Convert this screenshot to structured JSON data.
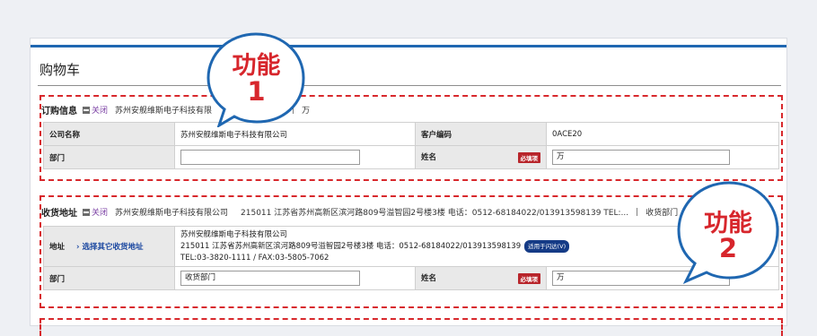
{
  "page": {
    "title": "购物车"
  },
  "order_section": {
    "header": {
      "name": "订购信息",
      "close_label": "关闭",
      "company": "苏州安舰维斯电子科技有限",
      "after": "万"
    },
    "rows": {
      "company_label": "公司名称",
      "company_value": "苏州安舰维斯电子科技有限公司",
      "code_label": "客户编码",
      "code_value": "0ACE20",
      "dept_label": "部门",
      "dept_value": "",
      "name_label": "姓名",
      "name_required": "必填项",
      "name_value": "万"
    }
  },
  "ship_section": {
    "header": {
      "name": "收货地址",
      "close_label": "关闭",
      "company": "苏州安舰维斯电子科技有限公司",
      "address": "215011 江苏省苏州高新区滨河路809号溢智园2号楼3楼 电话：0512-68184022/013913598139 TEL:...",
      "dept": "收货部门"
    },
    "rows": {
      "address_label": "地址",
      "address_link": "› 选择其它收货地址",
      "addr_line1": "苏州安舰维斯电子科技有限公司",
      "addr_line2": "215011 江苏省苏州高新区滨河路809号溢智园2号楼3楼 电话：0512-68184022/013913598139",
      "addr_badge": "适用于闪达(V)",
      "addr_line3": "TEL:03-3820-1111 / FAX:03-5805-7062",
      "dept_label": "部门",
      "dept_value": "收货部门",
      "name_label": "姓名",
      "name_required": "必填项",
      "name_value": "万"
    }
  },
  "callouts": {
    "one": {
      "line1": "功能",
      "line2": "1"
    },
    "two": {
      "line1": "功能",
      "line2": "2"
    }
  },
  "colors": {
    "accent_blue": "#1f67b1",
    "dash_red": "#d8282c",
    "required_red": "#b8252b"
  }
}
